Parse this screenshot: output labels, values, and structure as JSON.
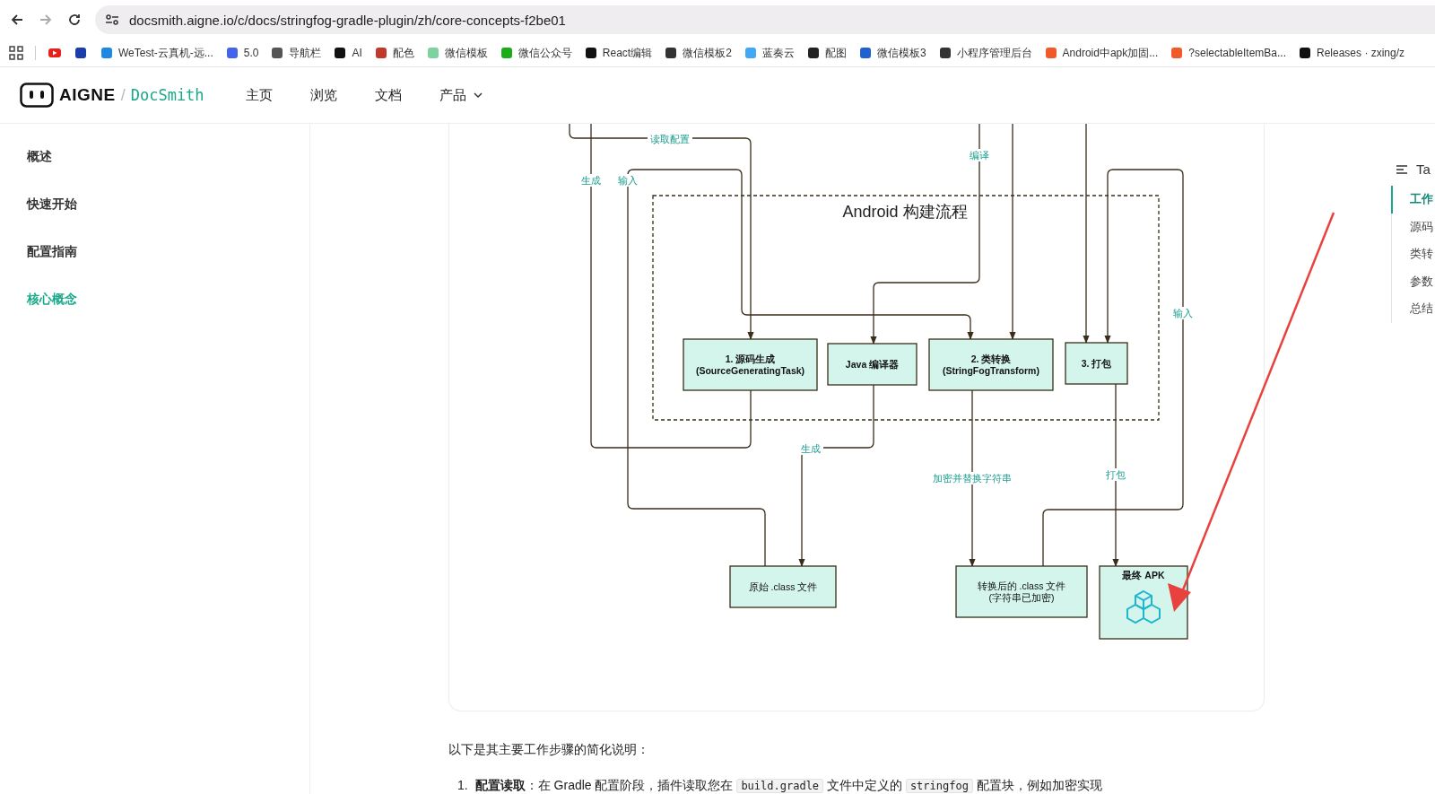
{
  "browser": {
    "url": "docsmith.aigne.io/c/docs/stringfog-gradle-plugin/zh/core-concepts-f2be01",
    "bookmarks": [
      {
        "kind": "icon"
      },
      {
        "kind": "icon"
      },
      {
        "kind": "labeled",
        "label": "WeTest-云真机-远..."
      },
      {
        "kind": "labeled",
        "label": "5.0"
      },
      {
        "kind": "labeled",
        "label": "导航栏"
      },
      {
        "kind": "labeled",
        "label": "AI"
      },
      {
        "kind": "labeled",
        "label": "配色"
      },
      {
        "kind": "labeled",
        "label": "微信模板"
      },
      {
        "kind": "labeled",
        "label": "微信公众号"
      },
      {
        "kind": "labeled",
        "label": "React编辑"
      },
      {
        "kind": "labeled",
        "label": "微信模板2"
      },
      {
        "kind": "labeled",
        "label": "蓝奏云"
      },
      {
        "kind": "labeled",
        "label": "配图"
      },
      {
        "kind": "labeled",
        "label": "微信模板3"
      },
      {
        "kind": "labeled",
        "label": "小程序管理后台"
      },
      {
        "kind": "labeled",
        "label": "Android中apk加固..."
      },
      {
        "kind": "labeled",
        "label": "?selectableItemBa..."
      },
      {
        "kind": "labeled",
        "label": "Releases · zxing/z"
      }
    ]
  },
  "header": {
    "brand": "AIGNE",
    "separator": "/",
    "product": "DocSmith",
    "nav": [
      {
        "label": "主页",
        "kind": "link"
      },
      {
        "label": "浏览",
        "kind": "link"
      },
      {
        "label": "文档",
        "kind": "link"
      },
      {
        "label": "产品",
        "kind": "dropdown"
      }
    ]
  },
  "sidebar": {
    "items": [
      {
        "label": "概述",
        "selected": false
      },
      {
        "label": "快速开始",
        "selected": false
      },
      {
        "label": "配置指南",
        "selected": false
      },
      {
        "label": "核心概念",
        "selected": true
      }
    ]
  },
  "diagram": {
    "cluster_title": "Android 构建流程",
    "nodes": [
      {
        "lines": [
          "1. 源码生成",
          "(SourceGeneratingTask)"
        ],
        "kind": "task"
      },
      {
        "lines": [
          "Java 编译器"
        ],
        "kind": "task"
      },
      {
        "lines": [
          "2. 类转换",
          "(StringFogTransform)"
        ],
        "kind": "task"
      },
      {
        "lines": [
          "3. 打包"
        ],
        "kind": "task"
      },
      {
        "lines": [
          "原始 .class 文件"
        ],
        "kind": "file"
      },
      {
        "lines": [
          "转换后的 .class 文件",
          "(字符串已加密)"
        ],
        "kind": "file"
      },
      {
        "lines": [
          "最终 APK"
        ],
        "kind": "apk"
      }
    ],
    "edges": [
      {
        "kind": "labeled",
        "label": "读取配置"
      },
      {
        "kind": "labeled",
        "label": "生成"
      },
      {
        "kind": "labeled",
        "label": "输入"
      },
      {
        "kind": "labeled",
        "label": "编译"
      },
      {
        "kind": "plain"
      },
      {
        "kind": "plain"
      },
      {
        "kind": "labeled",
        "label": "输入"
      },
      {
        "kind": "labeled",
        "label": "生成"
      },
      {
        "kind": "labeled",
        "label": "加密并替换字符串"
      },
      {
        "kind": "labeled",
        "label": "打包"
      }
    ]
  },
  "content": {
    "intro": "以下是其主要工作步骤的简化说明：",
    "steps": [
      {
        "number": "1.",
        "segments": [
          {
            "kind": "bold",
            "text": "配置读取"
          },
          {
            "kind": "text",
            "text": "：在 Gradle 配置阶段，插件读取您在 "
          },
          {
            "kind": "code",
            "text": "build.gradle"
          },
          {
            "kind": "text",
            "text": " 文件中定义的 "
          },
          {
            "kind": "code",
            "text": "stringfog"
          },
          {
            "kind": "text",
            "text": " 配置块，例如加密实现"
          }
        ]
      }
    ]
  },
  "toc": {
    "title": "Ta",
    "items": [
      {
        "label": "工作",
        "selected": true
      },
      {
        "label": "源码",
        "selected": false
      },
      {
        "label": "类转",
        "selected": false
      },
      {
        "label": "参数",
        "selected": false
      },
      {
        "label": "总结",
        "selected": false
      }
    ]
  }
}
